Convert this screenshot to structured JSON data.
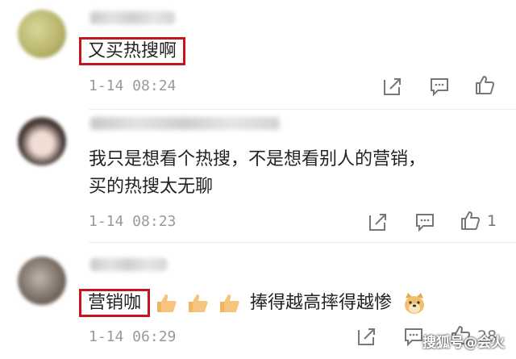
{
  "comments": [
    {
      "text": "又买热搜啊",
      "time": "1-14 08:24",
      "like_count": ""
    },
    {
      "text_line1": "我只是想看个热搜，不是想看别人的营销，",
      "text_line2": "买的热搜太无聊",
      "time": "1-14 08:23",
      "like_count": "1"
    },
    {
      "text_main": "营销咖",
      "text_after": "捧得越高摔得越惨",
      "time": "1-14 06:29",
      "like_count": "28"
    }
  ],
  "icons": {
    "share": "share-icon",
    "reply": "comment-icon",
    "like": "thumbs-up-icon"
  },
  "watermark": "搜狐号@会火",
  "colors": {
    "highlight_border": "#c5161d",
    "meta_text": "#999999"
  }
}
